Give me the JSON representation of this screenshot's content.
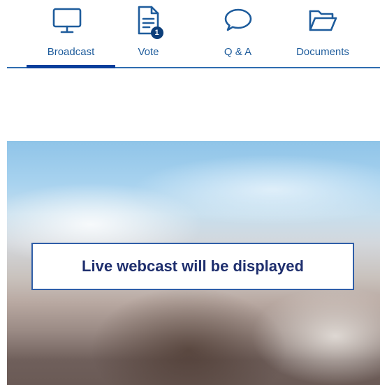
{
  "tabs": {
    "broadcast": {
      "label": "Broadcast",
      "active": true
    },
    "vote": {
      "label": "Vote",
      "badge": "1"
    },
    "qa": {
      "label": "Q & A"
    },
    "documents": {
      "label": "Documents"
    }
  },
  "video": {
    "caption": "Live webcast will be displayed"
  },
  "colors": {
    "accent": "#1e5c9c",
    "active_underline": "#0a3f9c",
    "badge": "#0c3e7a",
    "caption_text": "#1f2f6e"
  },
  "icons": {
    "broadcast": "monitor-icon",
    "vote": "document-icon",
    "qa": "speech-bubble-icon",
    "documents": "folder-icon"
  }
}
